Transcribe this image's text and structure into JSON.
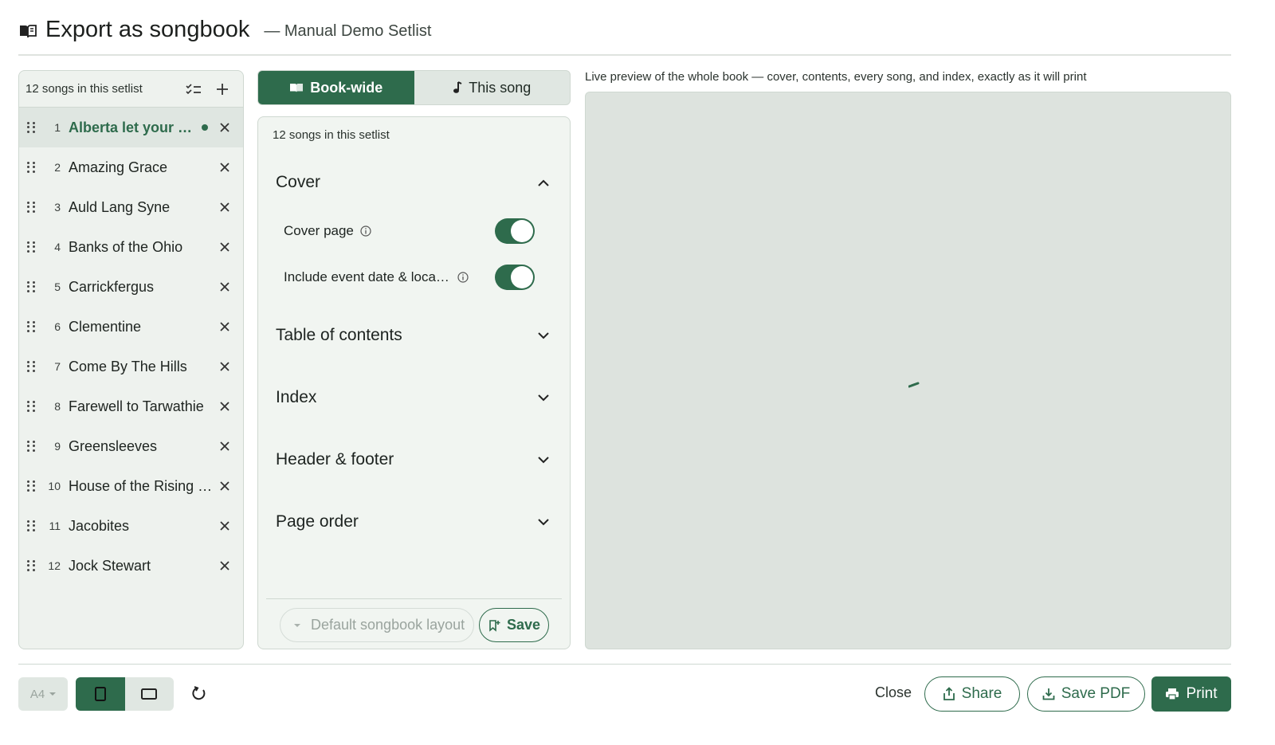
{
  "header": {
    "title": "Export as songbook",
    "subtitle": "— Manual Demo Setlist"
  },
  "songs_panel": {
    "count_label": "12 songs in this setlist",
    "songs": [
      {
        "num": "1",
        "title": "Alberta let your hair hang low"
      },
      {
        "num": "2",
        "title": "Amazing Grace"
      },
      {
        "num": "3",
        "title": "Auld Lang Syne"
      },
      {
        "num": "4",
        "title": "Banks of the Ohio"
      },
      {
        "num": "5",
        "title": "Carrickfergus"
      },
      {
        "num": "6",
        "title": "Clementine"
      },
      {
        "num": "7",
        "title": "Come By The Hills"
      },
      {
        "num": "8",
        "title": "Farewell to Tarwathie"
      },
      {
        "num": "9",
        "title": "Greensleeves"
      },
      {
        "num": "10",
        "title": "House of the Rising Sun"
      },
      {
        "num": "11",
        "title": "Jacobites"
      },
      {
        "num": "12",
        "title": "Jock Stewart"
      }
    ]
  },
  "tabs": {
    "book_wide": "Book-wide",
    "this_song": "This song"
  },
  "settings": {
    "count_label": "12 songs in this setlist",
    "sections": {
      "cover": "Cover",
      "toc": "Table of contents",
      "index": "Index",
      "header_footer": "Header & footer",
      "page_order": "Page order"
    },
    "cover_options": {
      "cover_page": "Cover page",
      "event_date": "Include event date & location",
      "cover_page_on": true,
      "event_date_on": true
    },
    "layout_select": "Default songbook layout",
    "save_label": "Save"
  },
  "preview": {
    "caption": "Live preview of the whole book — cover, contents, every song, and index, exactly as it will print"
  },
  "footer": {
    "paper_size": "A4",
    "close": "Close",
    "share": "Share",
    "save_pdf": "Save PDF",
    "print": "Print"
  },
  "colors": {
    "accent": "#2e6b4c",
    "panel_bg": "#eef2ee",
    "preview_bg": "#dde3de"
  }
}
